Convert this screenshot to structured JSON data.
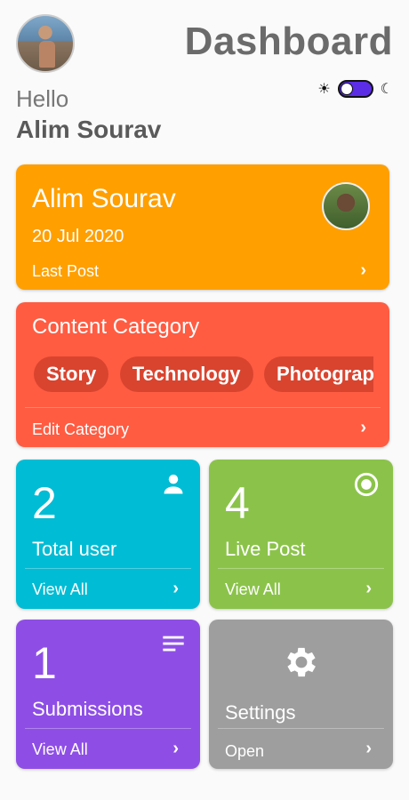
{
  "header": {
    "title": "Dashboard",
    "greeting": "Hello",
    "user_name": "Alim Sourav",
    "theme_toggle": {
      "on": true,
      "sun_icon": "sun-icon",
      "moon_icon": "moon-icon"
    }
  },
  "post_card": {
    "name": "Alim Sourav",
    "date": "20 Jul 2020",
    "footer": "Last Post",
    "color": "#ff9f00"
  },
  "category_card": {
    "title": "Content Category",
    "chips": [
      "Story",
      "Technology",
      "Photography"
    ],
    "footer": "Edit Category",
    "color": "#ff5c42"
  },
  "tiles": {
    "users": {
      "count": "2",
      "label": "Total user",
      "action": "View All",
      "icon": "person-icon",
      "color": "#00bcd4"
    },
    "live": {
      "count": "4",
      "label": "Live Post",
      "action": "View All",
      "icon": "radio-button-icon",
      "color": "#8bc34a"
    },
    "submissions": {
      "count": "1",
      "label": "Submissions",
      "action": "View All",
      "icon": "list-icon",
      "color": "#8e4ee6"
    },
    "settings": {
      "label": "Settings",
      "action": "Open",
      "icon": "gear-icon",
      "color": "#9e9e9e"
    }
  }
}
